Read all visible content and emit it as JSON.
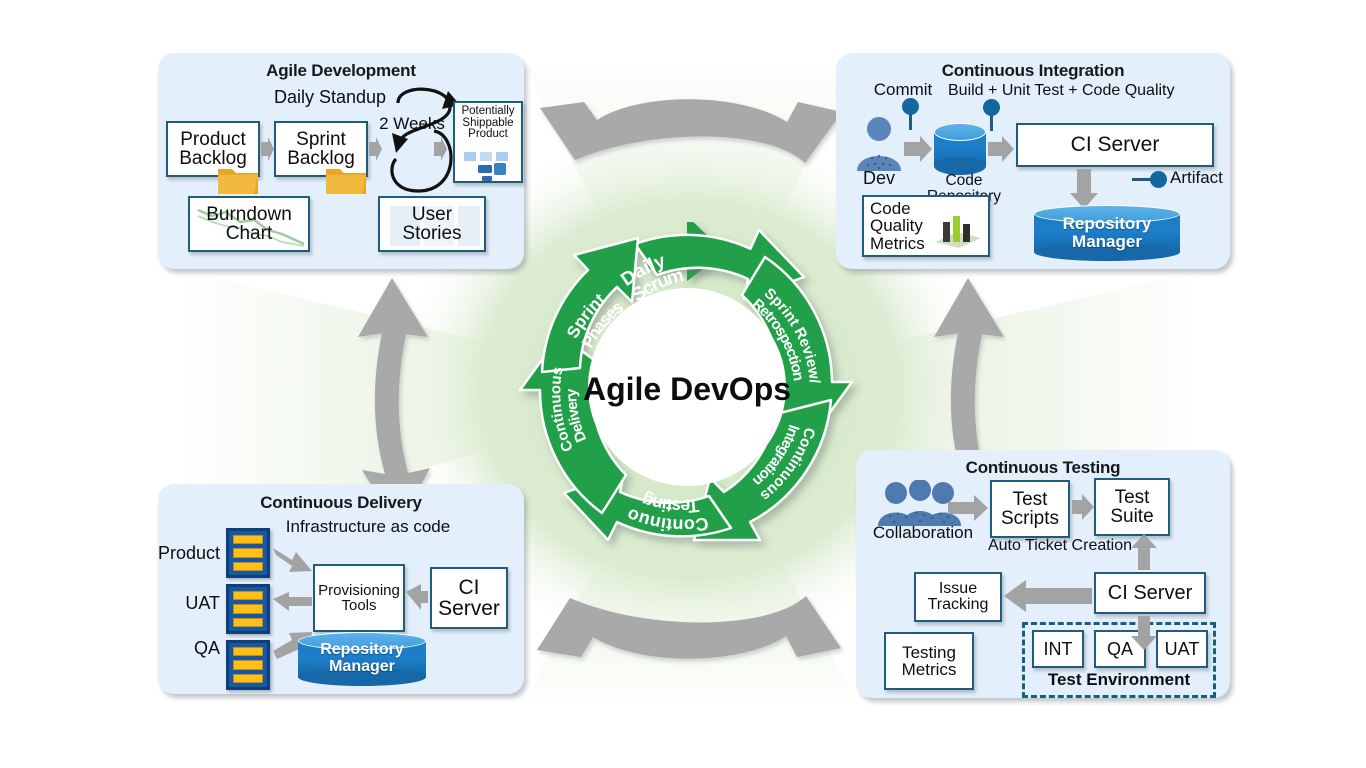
{
  "wheel": {
    "center_line1": "Agile",
    "center_line2": "DevOps",
    "accent_green": "#21a04a",
    "segments": [
      {
        "id": "daily-scrum",
        "line1": "Daily",
        "line2": "Scrum"
      },
      {
        "id": "sprint-review",
        "line1": "Sprint Review/",
        "line2": "Retrospection"
      },
      {
        "id": "continuous-integration",
        "line1": "Continuous",
        "line2": "Integration"
      },
      {
        "id": "continuous-testing",
        "line1": "Continuous",
        "line2": "Testing"
      },
      {
        "id": "continuous-delivery",
        "line1": "Continuous",
        "line2": "Delivery"
      },
      {
        "id": "sprint-phases",
        "line1": "Sprint",
        "line2": "Phases"
      }
    ]
  },
  "agile_development": {
    "title": "Agile Development",
    "daily_standup": "Daily Standup",
    "two_weeks_line1": "2",
    "two_weeks_line2": "Weeks",
    "product_backlog_line1": "Product",
    "product_backlog_line2": "Backlog",
    "sprint_backlog_line1": "Sprint",
    "sprint_backlog_line2": "Backlog",
    "potentially_line1": "Potentially",
    "potentially_line2": "Shippable",
    "potentially_line3": "Product",
    "burndown_line1": "Burndown",
    "burndown_line2": "Chart",
    "user_stories_line1": "User",
    "user_stories_line2": "Stories"
  },
  "continuous_integration": {
    "title": "Continuous Integration",
    "commit": "Commit",
    "build_unit_test": "Build + Unit Test + Code Quality",
    "dev": "Dev",
    "code_repository_line1": "Code",
    "code_repository_line2": "Repository",
    "ci_server": "CI Server",
    "artifact": "Artifact",
    "code_quality_line1": "Code",
    "code_quality_line2": "Quality",
    "code_quality_line3": "Metrics",
    "repository_manager_line1": "Repository",
    "repository_manager_line2": "Manager"
  },
  "continuous_delivery": {
    "title": "Continuous Delivery",
    "infrastructure_line1": "Infrastructure as",
    "infrastructure_line2": "code",
    "env_product": "Product",
    "env_uat": "UAT",
    "env_qa": "QA",
    "provisioning_line1": "Provisioning",
    "provisioning_line2": "Tools",
    "ci_server_line1": "CI",
    "ci_server_line2": "Server",
    "repository_manager_line1": "Repository",
    "repository_manager_line2": "Manager"
  },
  "continuous_testing": {
    "title": "Continuous Testing",
    "collaboration": "Collaboration",
    "test_scripts_line1": "Test",
    "test_scripts_line2": "Scripts",
    "test_suite_line1": "Test",
    "test_suite_line2": "Suite",
    "auto_ticket_line1": "Auto",
    "auto_ticket_line2": "Ticket Creation",
    "issue_tracking_line1": "Issue",
    "issue_tracking_line2": "Tracking",
    "ci_server": "CI Server",
    "testing_metrics_line1": "Testing",
    "testing_metrics_line2": "Metrics",
    "env_int": "INT",
    "env_qa": "QA",
    "env_uat": "UAT",
    "test_environment": "Test Environment"
  },
  "colors": {
    "panel_bg": "#e3effa",
    "box_border": "#1f5d7d",
    "wheel_green": "#21a04a",
    "cylinder_blue": "#1c7cc6",
    "rack_blue": "#1558a8",
    "rack_bar": "#fcbf1e",
    "connector_gray": "#a8a8a8",
    "folder_orange": "#eda92b"
  }
}
